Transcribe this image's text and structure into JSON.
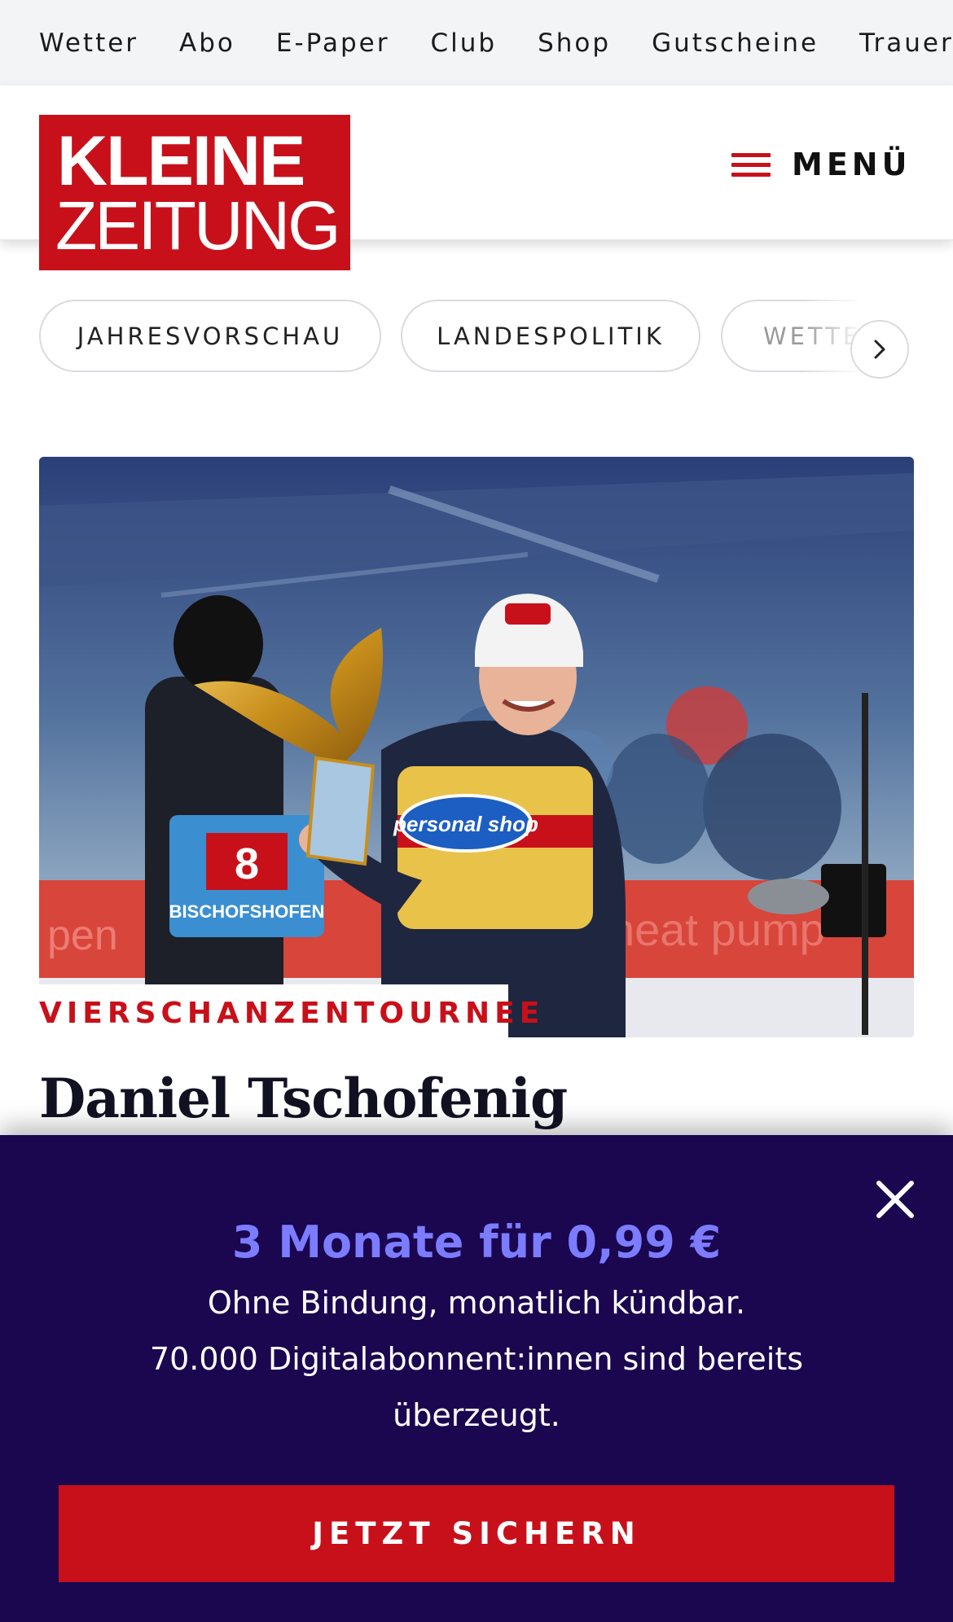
{
  "topnav": {
    "items": [
      "Wetter",
      "Abo",
      "E-Paper",
      "Club",
      "Shop",
      "Gutscheine",
      "Trauerportal"
    ]
  },
  "header": {
    "logo_line1": "KLEINE",
    "logo_line2": "ZEITUNG",
    "menu_label": "MENÜ"
  },
  "topics": {
    "chips": [
      "JAHRESVORSCHAU",
      "LANDESPOLITIK",
      "WETTER"
    ]
  },
  "article": {
    "kicker": "VIERSCHANZENTOURNEE",
    "headline": "Daniel Tschofenig",
    "image": {
      "bib_number": "8",
      "bib_text": "BISCHOFSHOFEN",
      "sponsor": "personal shop"
    }
  },
  "paywall": {
    "offer": "3 Monate für 0,99 €",
    "line1": "Ohne Bindung, monatlich kündbar.",
    "line2": "70.000 Digitalabonnent:innen sind bereits überzeugt.",
    "cta_label": "JETZT SICHERN"
  },
  "colors": {
    "brand_red": "#c8101a",
    "paywall_bg": "#1b0650",
    "offer_accent": "#7b7cff"
  }
}
